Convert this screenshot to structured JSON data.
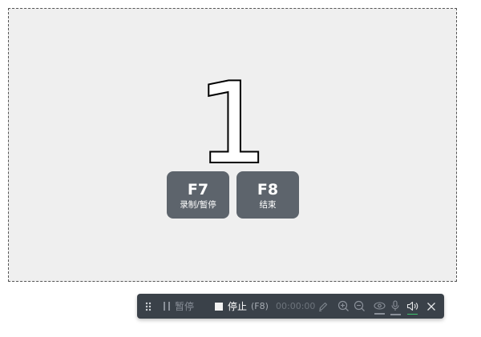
{
  "countdown": {
    "value": "1"
  },
  "hotkeys": [
    {
      "key": "F7",
      "label": "录制/暂停"
    },
    {
      "key": "F8",
      "label": "结束"
    }
  ],
  "toolbar": {
    "pause_label": "暂停",
    "stop_label": "停止",
    "stop_shortcut": "(F8)",
    "timer": "00:00:00",
    "icons": {
      "drag": "drag-handle-icon",
      "pause": "pause-icon",
      "stop": "stop-icon",
      "pen": "pen-icon",
      "zoom_in": "zoom-in-icon",
      "zoom_out": "zoom-out-icon",
      "camera": "camera-icon",
      "mic": "microphone-icon",
      "speaker": "speaker-icon",
      "close": "close-icon"
    },
    "colors": {
      "background": "#3a4149",
      "speaker_active": "#3ec46d",
      "inactive": "#8a9099"
    }
  },
  "colors": {
    "capture_area_bg": "#efefef",
    "hotkey_bg": "#5d646c"
  }
}
